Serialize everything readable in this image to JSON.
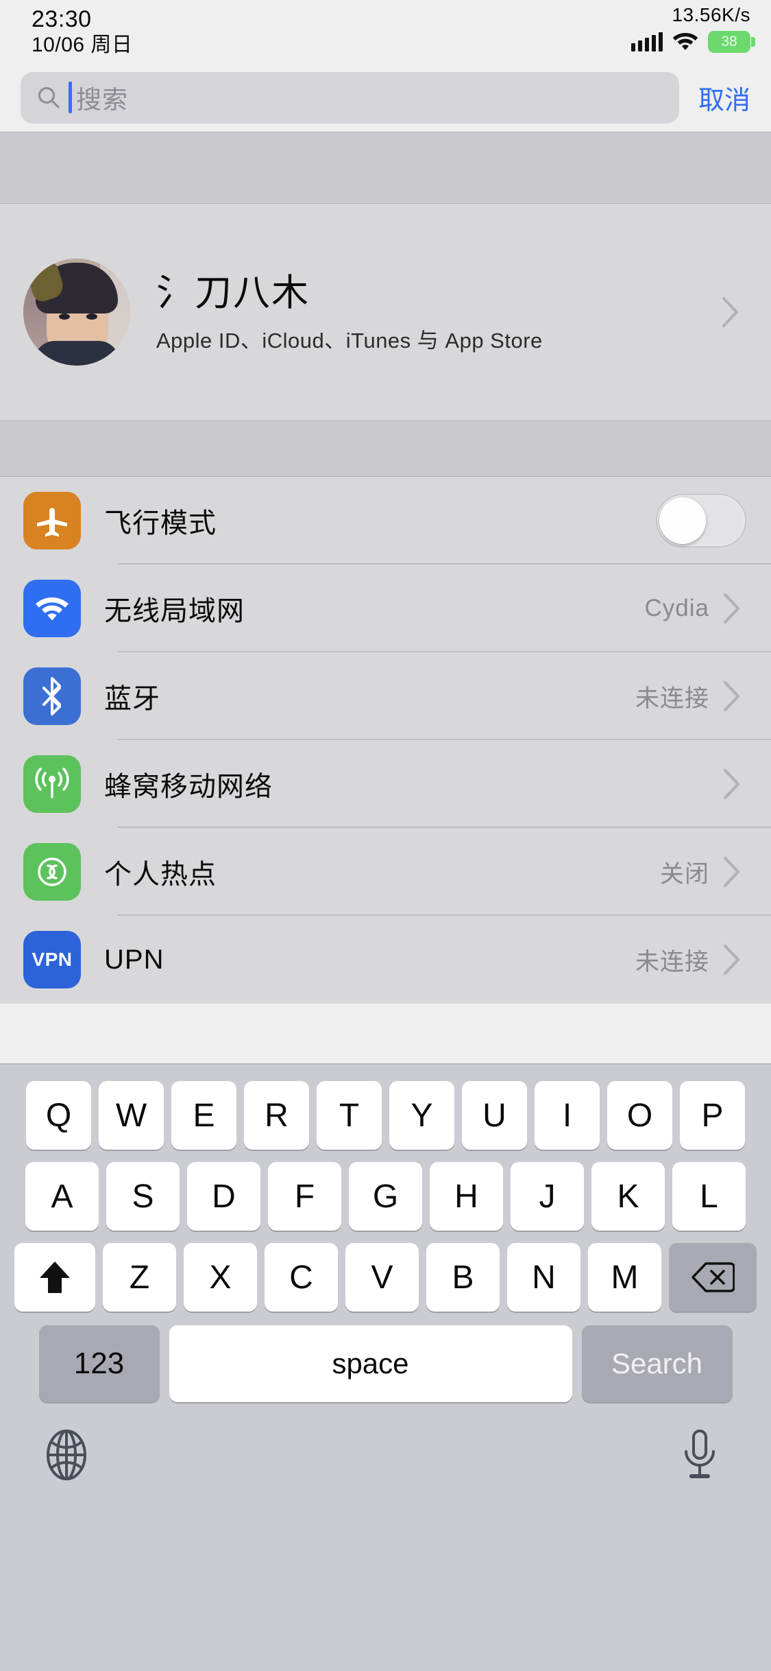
{
  "status_bar": {
    "time": "23:30",
    "date": "10/06 周日",
    "network_speed": "13.56K/s",
    "battery_level": "38",
    "battery_color": "#6bd96b",
    "signal_icon": "cellular-signal-icon",
    "wifi_icon": "wifi-icon"
  },
  "search": {
    "placeholder": "搜索",
    "value": "",
    "cancel_label": "取消",
    "icon": "search-icon",
    "accent_color": "#2f6ef0"
  },
  "apple_id": {
    "name": "氵刀八木",
    "subtitle": "Apple ID、iCloud、iTunes 与 App Store",
    "avatar": "user-avatar",
    "chevron": "chevron-right-icon"
  },
  "settings_rows": [
    {
      "label": "飞行模式",
      "value": "",
      "icon": "airplane-icon",
      "icon_color": "#d98221",
      "control": "toggle",
      "toggle_on": false,
      "name": "airplane-mode"
    },
    {
      "label": "无线局域网",
      "value": "Cydia",
      "icon": "wifi-icon",
      "icon_color": "#2f6ef0",
      "control": "chevron",
      "name": "wifi"
    },
    {
      "label": "蓝牙",
      "value": "未连接",
      "icon": "bluetooth-icon",
      "icon_color": "#3b6fd4",
      "control": "chevron",
      "name": "bluetooth"
    },
    {
      "label": "蜂窝移动网络",
      "value": "",
      "icon": "cellular-icon",
      "icon_color": "#5cc25c",
      "control": "chevron",
      "name": "cellular"
    },
    {
      "label": "个人热点",
      "value": "关闭",
      "icon": "hotspot-icon",
      "icon_color": "#5cc25c",
      "control": "chevron",
      "name": "personal-hotspot"
    },
    {
      "label": "UPN",
      "value": "未连接",
      "icon": "vpn-icon",
      "icon_color": "#2d63d8",
      "icon_text": "VPN",
      "control": "chevron",
      "name": "vpn"
    }
  ],
  "keyboard": {
    "row1": [
      "Q",
      "W",
      "E",
      "R",
      "T",
      "Y",
      "U",
      "I",
      "O",
      "P"
    ],
    "row2": [
      "A",
      "S",
      "D",
      "F",
      "G",
      "H",
      "J",
      "K",
      "L"
    ],
    "row3": [
      "Z",
      "X",
      "C",
      "V",
      "B",
      "N",
      "M"
    ],
    "shift_icon": "shift-arrow-icon",
    "delete_icon": "backspace-icon",
    "numbers_label": "123",
    "space_label": "space",
    "return_label": "Search",
    "globe_icon": "globe-icon",
    "mic_icon": "microphone-icon"
  }
}
